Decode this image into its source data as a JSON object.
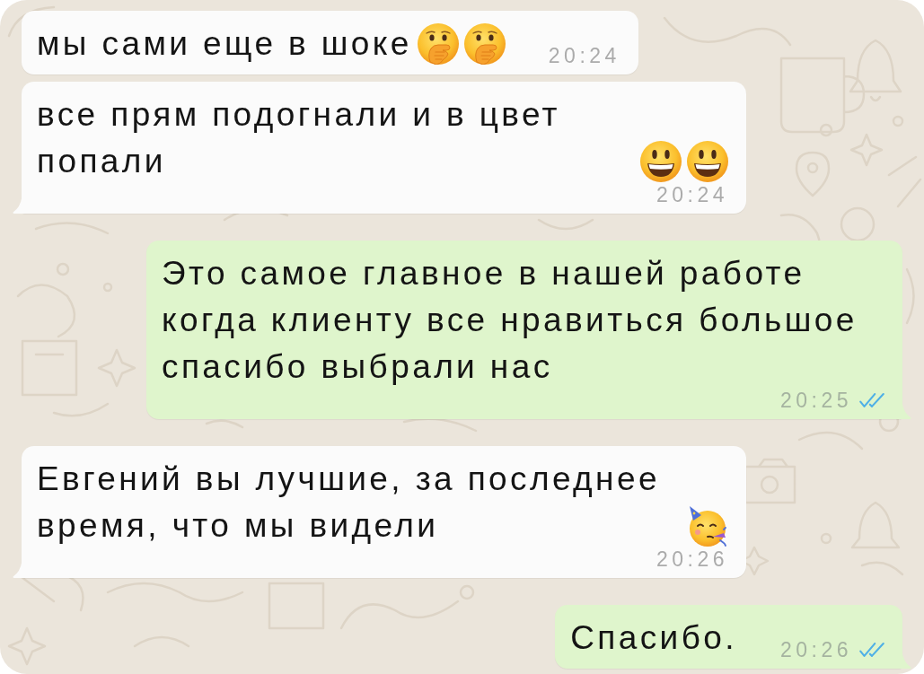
{
  "messages": [
    {
      "outgoing": false,
      "tail": false,
      "text": "мы сами еще в шоке",
      "emojis": [
        {
          "kind": "hand-over-mouth"
        },
        {
          "kind": "hand-over-mouth"
        }
      ],
      "time": "20:24"
    },
    {
      "outgoing": false,
      "tail": true,
      "text": "все прям подогнали и в цвет попали",
      "emojis": [
        {
          "kind": "grinning"
        },
        {
          "kind": "grinning"
        }
      ],
      "time": "20:24"
    },
    {
      "outgoing": true,
      "tail": true,
      "text": "Это самое главное в нашей работе когда клиенту все нравиться большое спасибо выбрали нас",
      "time": "20:25",
      "read": true
    },
    {
      "outgoing": false,
      "tail": true,
      "text": "Евгений вы лучшие, за последнее время, что мы видели",
      "emojis": [
        {
          "kind": "partying"
        }
      ],
      "time": "20:26"
    },
    {
      "outgoing": true,
      "tail": true,
      "text": "Спасибо.",
      "time": "20:26",
      "read": true
    }
  ]
}
